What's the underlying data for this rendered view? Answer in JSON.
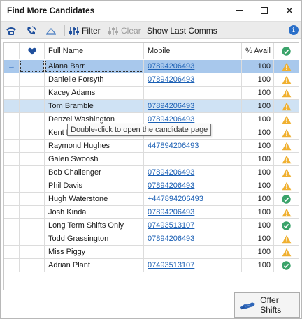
{
  "window": {
    "title": "Find More Candidates"
  },
  "toolbar": {
    "filter_label": "Filter",
    "clear_label": "Clear",
    "show_last_comms_label": "Show Last Comms"
  },
  "grid": {
    "columns": {
      "full_name": "Full Name",
      "mobile": "Mobile",
      "avail": "% Avail"
    },
    "rows": [
      {
        "name": "Alana Barr",
        "mobile": "07894206493",
        "avail": "100",
        "status": "warning"
      },
      {
        "name": "Danielle Forsyth",
        "mobile": "07894206493",
        "avail": "100",
        "status": "warning"
      },
      {
        "name": "Kacey Adams",
        "mobile": "",
        "avail": "100",
        "status": "warning"
      },
      {
        "name": "Tom Bramble",
        "mobile": "07894206493",
        "avail": "100",
        "status": "warning"
      },
      {
        "name": "Denzel Washington",
        "mobile": "07894206493",
        "avail": "100",
        "status": "warning"
      },
      {
        "name": "Kent B",
        "mobile": "",
        "avail": "100",
        "status": "warning"
      },
      {
        "name": "Raymond Hughes",
        "mobile": "447894206493",
        "avail": "100",
        "status": "warning"
      },
      {
        "name": "Galen Swoosh",
        "mobile": "",
        "avail": "100",
        "status": "warning"
      },
      {
        "name": "Bob Challenger",
        "mobile": "07894206493",
        "avail": "100",
        "status": "warning"
      },
      {
        "name": "Phil Davis",
        "mobile": "07894206493",
        "avail": "100",
        "status": "warning"
      },
      {
        "name": "Hugh Waterstone",
        "mobile": "+447894206493",
        "avail": "100",
        "status": "ok"
      },
      {
        "name": "Josh Kinda",
        "mobile": "07894206493",
        "avail": "100",
        "status": "warning"
      },
      {
        "name": "Long Term Shifts Only",
        "mobile": "07493513107",
        "avail": "100",
        "status": "ok"
      },
      {
        "name": "Todd Grassington",
        "mobile": "07894206493",
        "avail": "100",
        "status": "warning"
      },
      {
        "name": "Miss Piggy",
        "mobile": "",
        "avail": "100",
        "status": "warning"
      },
      {
        "name": "Adrian Plant",
        "mobile": "07493513107",
        "avail": "100",
        "status": "ok"
      }
    ]
  },
  "tooltip": {
    "text": "Double-click to open the candidate page"
  },
  "footer": {
    "offer_shifts_label": "Offer Shifts"
  },
  "colors": {
    "selected_row": "#a8c8ec",
    "hover_row": "#cfe2f4",
    "link": "#1a5fb4",
    "warning": "#f0b030",
    "ok": "#3aa36a"
  }
}
